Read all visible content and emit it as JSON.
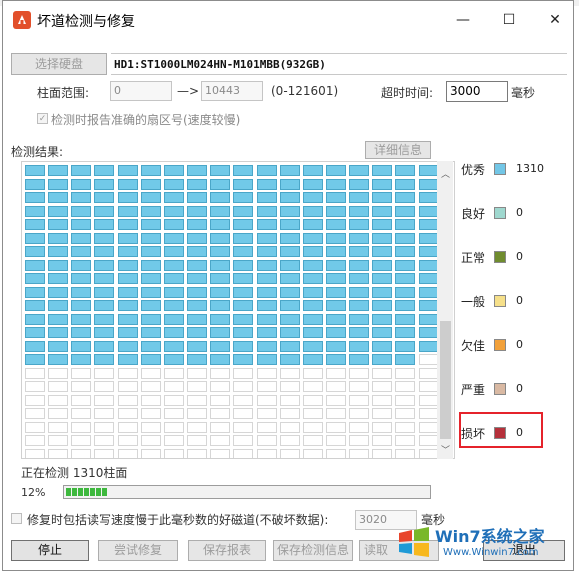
{
  "window": {
    "title": "坏道检测与修复",
    "minimize": "—",
    "maximize": "☐",
    "close": "✕"
  },
  "disk": {
    "select_button": "选择硬盘",
    "name": "HD1:ST1000LM024HN-M101MBB(932GB)"
  },
  "range": {
    "label": "柱面范围:",
    "start": "0",
    "arrow": "—>",
    "end": "10443",
    "total": "(0-121601)"
  },
  "timeout": {
    "label": "超时时间:",
    "value": "3000",
    "unit": "毫秒"
  },
  "report_sector": {
    "label": "检测时报告准确的扇区号(速度较慢)",
    "checked": true
  },
  "results": {
    "label": "检测结果:",
    "detail_button": "详细信息",
    "done_cells": 269,
    "total_cells": 396,
    "columns": 18
  },
  "legend": [
    {
      "label": "优秀",
      "color": "#72c6e6",
      "count": "1310"
    },
    {
      "label": "良好",
      "color": "#9fd8cf",
      "count": "0"
    },
    {
      "label": "正常",
      "color": "#6f8c2e",
      "count": "0"
    },
    {
      "label": "一般",
      "color": "#f6e08a",
      "count": "0"
    },
    {
      "label": "欠佳",
      "color": "#f2a13a",
      "count": "0"
    },
    {
      "label": "严重",
      "color": "#d9b9a3",
      "count": "0"
    },
    {
      "label": "损坏",
      "color": "#b5303a",
      "count": "0"
    }
  ],
  "status": {
    "text": "正在检测 1310柱面",
    "percent_label": "12%",
    "progress": 0.12
  },
  "repair_option": {
    "label": "修复时包括读写速度慢于此毫秒数的好磁道(不破坏数据):",
    "value": "3020",
    "unit": "毫秒",
    "checked": false
  },
  "buttons": {
    "stop": "停止",
    "try_repair": "尝试修复",
    "save_report": "保存报表",
    "save_info": "保存检测信息",
    "read": "读取",
    "exit": "退出"
  },
  "watermark": {
    "text": "Win7系统之家",
    "url": "Www.Winwin7.com"
  }
}
